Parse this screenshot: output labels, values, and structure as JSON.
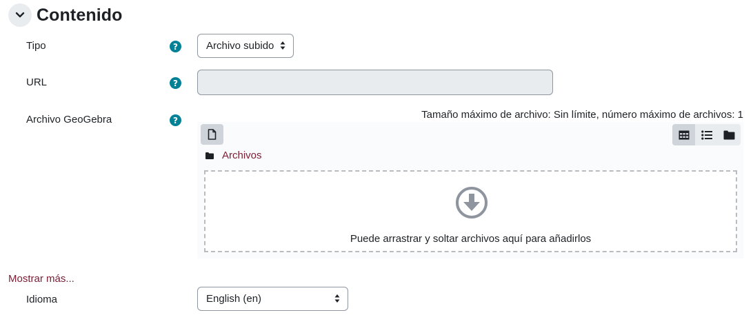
{
  "section": {
    "title": "Contenido",
    "toggle_icon": "chevron-down-icon"
  },
  "fields": {
    "tipo": {
      "label": "Tipo",
      "value": "Archivo subido"
    },
    "url": {
      "label": "URL",
      "value": ""
    },
    "archivo": {
      "label": "Archivo GeoGebra"
    }
  },
  "filemanager": {
    "limit_text": "Tamaño máximo de archivo: Sin límite, número máximo de archivos: 1",
    "path_label": "Archivos",
    "drop_text": "Puede arrastrar y soltar archivos aquí para añadirlos",
    "icons": [
      "file-icon",
      "grid-view-icon",
      "list-view-icon",
      "folder-view-icon",
      "folder-icon",
      "download-arrow-icon"
    ]
  },
  "show_more": "Mostrar más...",
  "idioma": {
    "label": "Idioma",
    "value": "English (en)"
  },
  "colors": {
    "accent": "#7c1b33",
    "help": "#008196",
    "disabled_bg": "#e9ecef"
  }
}
